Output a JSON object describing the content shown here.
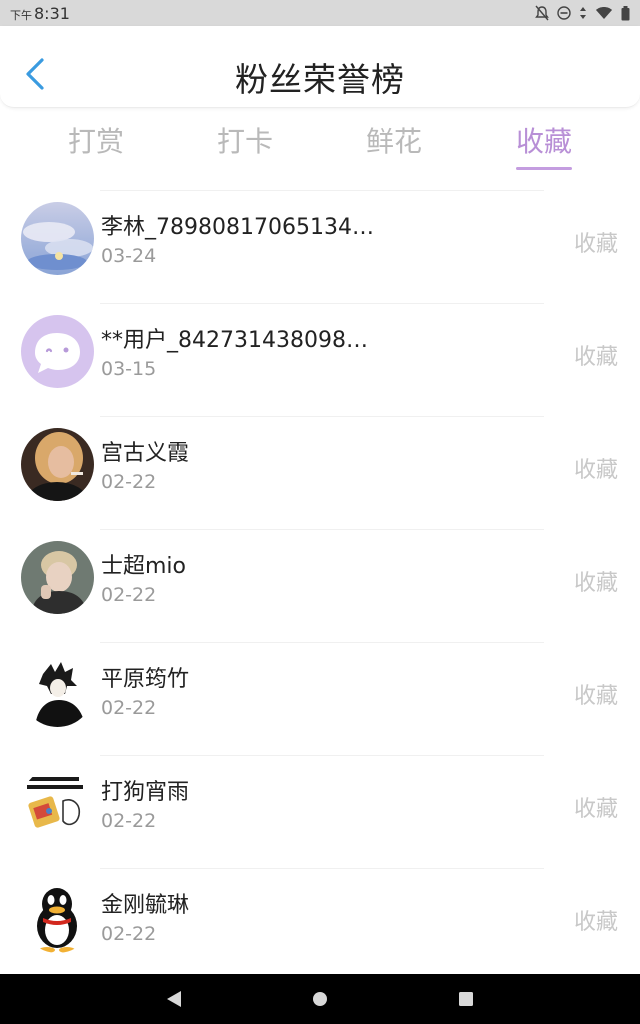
{
  "status_bar": {
    "ampm": "下午",
    "time": "8:31"
  },
  "header": {
    "title": "粉丝荣誉榜"
  },
  "tabs": [
    {
      "label": "打赏"
    },
    {
      "label": "打卡"
    },
    {
      "label": "鲜花"
    },
    {
      "label": "收藏"
    }
  ],
  "active_tab": "收藏",
  "fans": [
    {
      "name": "李林_78980817065134…",
      "date": "03-24",
      "action": "收藏"
    },
    {
      "name": "**用户_842731438098…",
      "date": "03-15",
      "action": "收藏"
    },
    {
      "name": "宫古义霞",
      "date": "02-22",
      "action": "收藏"
    },
    {
      "name": "士超mio",
      "date": "02-22",
      "action": "收藏"
    },
    {
      "name": "平原筠竹",
      "date": "02-22",
      "action": "收藏"
    },
    {
      "name": "打狗宵雨",
      "date": "02-22",
      "action": "收藏"
    },
    {
      "name": "金刚毓琳",
      "date": "02-22",
      "action": "收藏"
    }
  ],
  "colors": {
    "accent": "#b88fd6",
    "back_arrow": "#3a9be0"
  }
}
